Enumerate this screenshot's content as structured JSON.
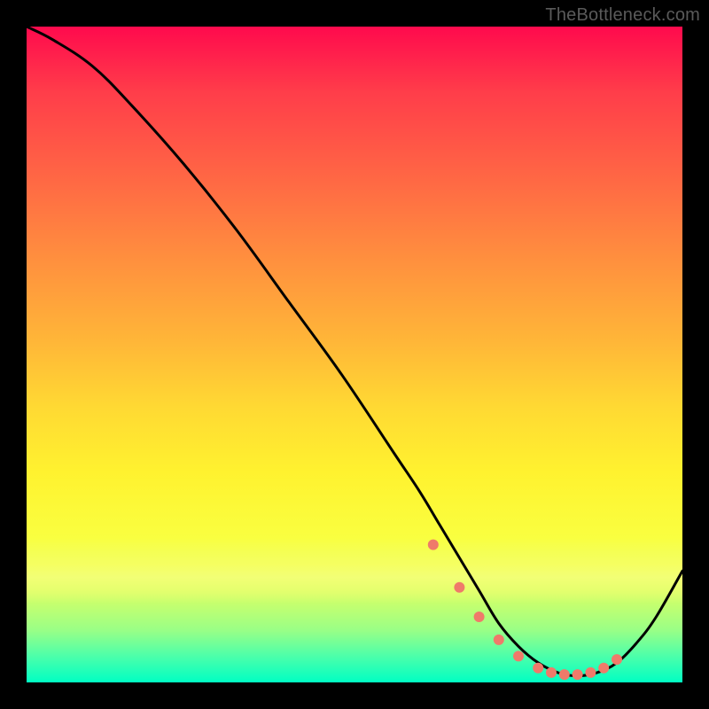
{
  "watermark": "TheBottleneck.com",
  "chart_data": {
    "type": "line",
    "title": "",
    "xlabel": "",
    "ylabel": "",
    "xlim": [
      0,
      100
    ],
    "ylim": [
      0,
      100
    ],
    "grid": false,
    "series": [
      {
        "name": "bottleneck-curve",
        "x": [
          0,
          4,
          10,
          16,
          24,
          32,
          40,
          48,
          56,
          60,
          63,
          66,
          69,
          72,
          75,
          78,
          81,
          84,
          87,
          90,
          93,
          96,
          100
        ],
        "y": [
          100,
          98,
          94,
          88,
          79,
          69,
          58,
          47,
          35,
          29,
          24,
          19,
          14,
          9,
          5.5,
          3,
          1.5,
          1,
          1.5,
          3,
          6,
          10,
          17
        ]
      }
    ],
    "markers": {
      "name": "optimal-range-dots",
      "color": "#ef7a6a",
      "x": [
        62,
        66,
        69,
        72,
        75,
        78,
        80,
        82,
        84,
        86,
        88,
        90
      ],
      "y": [
        21,
        14.5,
        10,
        6.5,
        4,
        2.2,
        1.5,
        1.2,
        1.2,
        1.5,
        2.2,
        3.5
      ]
    },
    "colors": {
      "curve": "#000000",
      "marker": "#ef7a6a",
      "background_top": "#ff0a4d",
      "background_bottom": "#00ffc3"
    }
  }
}
